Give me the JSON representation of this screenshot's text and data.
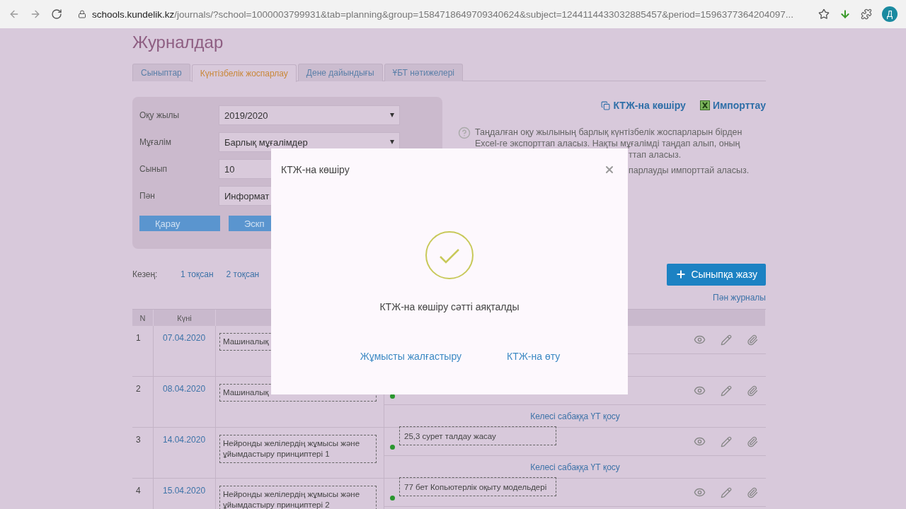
{
  "browser": {
    "url_host": "schools.kundelik.kz",
    "url_path": "/journals/?school=1000003799931&tab=planning&group=1584718649709340624&subject=1244114433032885457&period=1596377364204097...",
    "avatar": "Д"
  },
  "page": {
    "title": "Журналдар",
    "tabs": [
      {
        "label": "Сыныптар",
        "selected": false
      },
      {
        "label": "Күнтізбелік жоспарлау",
        "selected": true
      },
      {
        "label": "Дене дайындығы",
        "selected": false
      },
      {
        "label": "ҰБТ нәтижелері",
        "selected": false
      }
    ],
    "filters": [
      {
        "label": "Оқу жылы",
        "value": "2019/2020"
      },
      {
        "label": "Мұғалім",
        "value": "Барлық мұғалімдер"
      },
      {
        "label": "Сынып",
        "value": "10"
      },
      {
        "label": "Пән",
        "value": "Информат"
      }
    ],
    "filter_buttons": [
      "Қарау",
      "Эскп"
    ],
    "actions": [
      {
        "label": "КТЖ-на көшіру",
        "kind": "copy"
      },
      {
        "label": "Импорттау",
        "kind": "excel"
      }
    ],
    "help": {
      "text": "Таңдалған оқу жылының барлық күнтізбелік жоспарларын бірден Excel-ге экспорттап аласыз. Нақты мұғалімді таңдап алып, оның",
      "tail_lines": [
        "ттап аласыз.",
        "парлауды импорттай аласыз."
      ]
    },
    "period": {
      "label": "Кезең:",
      "items": [
        "1 тоқсан",
        "2 тоқсан"
      ]
    },
    "add_button": "Сыныпқа жазу",
    "subject_journal_link": "Пән журналы",
    "table": {
      "columns": [
        "N",
        "Күні"
      ],
      "rows": [
        {
          "n": "1",
          "date": "07.04.2020",
          "topic": "Машиналық"
        },
        {
          "n": "2",
          "date": "08.04.2020",
          "topic": "Машиналық",
          "homework_mark": true,
          "add_link": "Келесі сабаққа ҮТ қосу"
        },
        {
          "n": "3",
          "date": "14.04.2020",
          "topic": "Нейронды желілердің жұмысы және ұйымдастыру принциптері 1",
          "homework_mark": true,
          "homework": "25,3 сурет талдау жасау",
          "add_link": "Келесі сабаққа ҮТ қосу"
        },
        {
          "n": "4",
          "date": "15.04.2020",
          "topic": "Нейронды желілердің жұмысы және ұйымдастыру принциптері 2",
          "homework_mark": true,
          "homework": "77 бет Копьютерлік оқыту модельдері"
        }
      ]
    }
  },
  "dialog": {
    "title": "КТЖ-на көшіру",
    "message": "КТЖ-на көшіру сәтті аяқталды",
    "buttons": [
      "Жұмысты жалғастыру",
      "КТЖ-на өту"
    ]
  }
}
